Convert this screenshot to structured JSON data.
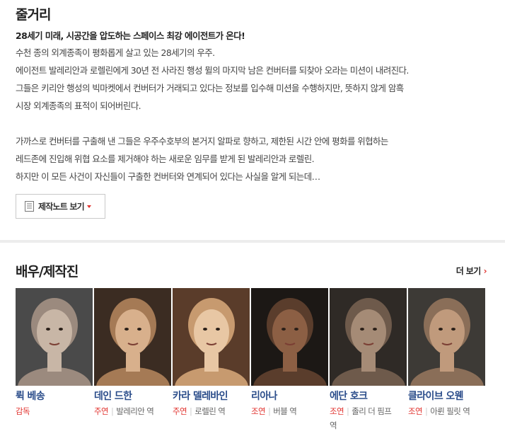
{
  "plot": {
    "title": "줄거리",
    "lead": "28세기 미래, 시공간을 압도하는 스페이스 최강 에이전트가 온다!",
    "lines": [
      "수천 종의 외계종족이 평화롭게 살고 있는 28세기의 우주.",
      " 에이전트 발레리안과 로렐린에게 30년 전 사라진 행성 뮐의 마지막 남은 컨버터를 되찾아 오라는 미션이 내려진다.",
      " 그들은 키리안 행성의 빅마켓에서 컨버터가 거래되고 있다는 정보를 입수해 미션을 수행하지만, 뜻하지 않게 암흑",
      "시장 외계종족의 표적이 되어버린다.",
      "",
      " 가까스로 컨버터를 구출해 낸 그들은 우주수호부의 본거지 알파로 향하고, 제한된 시간 안에 평화를 위협하는",
      " 레드존에 진입해 위협 요소를 제거해야 하는 새로운 임무를 받게 된 발레리안과 로렐린.",
      " 하지만 이 모든 사건이 자신들이 구출한 컨버터와 연계되어 있다는 사실을 알게 되는데…"
    ],
    "note_button_label": "제작노트 보기",
    "note_icon": "document-icon"
  },
  "cast": {
    "title": "배우/제작진",
    "more_label": "더 보기",
    "more_icon": "chevron-right-icon",
    "members": [
      {
        "name": "뤽 베송",
        "role_type": "감독",
        "role": "",
        "photo_colors": [
          "#4a4a4a",
          "#9b8a7e",
          "#c8b6a6"
        ]
      },
      {
        "name": "데인 드한",
        "role_type": "주연",
        "role": "발레리안 역",
        "photo_colors": [
          "#3b2c22",
          "#a57a55",
          "#d8b08c"
        ]
      },
      {
        "name": "카라 델레바인",
        "role_type": "주연",
        "role": "로렐린 역",
        "photo_colors": [
          "#5a3c2a",
          "#c79a6f",
          "#e8c7a4"
        ]
      },
      {
        "name": "리아나",
        "role_type": "조연",
        "role": "버블 역",
        "photo_colors": [
          "#1c1815",
          "#5a3d2c",
          "#8c5f44"
        ]
      },
      {
        "name": "에단 호크",
        "role_type": "조연",
        "role": "졸리 더 핌프 역",
        "photo_colors": [
          "#2f2a26",
          "#6e5a4b",
          "#a58b76"
        ]
      },
      {
        "name": "클라이브 오웬",
        "role_type": "조연",
        "role": "아륀 필릿 역",
        "photo_colors": [
          "#3d3a36",
          "#8a6e58",
          "#c09a7c"
        ]
      }
    ]
  },
  "colors": {
    "accent": "#e1322e",
    "name_blue": "#2a4c8a",
    "divider": "#ededed"
  }
}
